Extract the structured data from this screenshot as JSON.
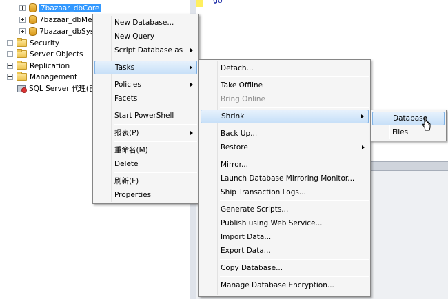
{
  "tree": {
    "databases": [
      "7bazaar_dbCore",
      "7bazaar_dbMer",
      "7bazaar_dbSyst"
    ],
    "folders": [
      "Security",
      "Server Objects",
      "Replication",
      "Management"
    ],
    "agent": "SQL Server 代理(已"
  },
  "editor": {
    "code": "go"
  },
  "menu1": {
    "new_database": "New Database...",
    "new_query": "New Query",
    "script_database_as": "Script Database as",
    "tasks": "Tasks",
    "policies": "Policies",
    "facets": "Facets",
    "start_powershell": "Start PowerShell",
    "reports": "报表(P)",
    "rename": "重命名(M)",
    "delete": "Delete",
    "refresh": "刷新(F)",
    "properties": "Properties"
  },
  "menu2": {
    "detach": "Detach...",
    "take_offline": "Take Offline",
    "bring_online": "Bring Online",
    "shrink": "Shrink",
    "back_up": "Back Up...",
    "restore": "Restore",
    "mirror": "Mirror...",
    "launch_mirroring_monitor": "Launch Database Mirroring Monitor...",
    "ship_transaction_logs": "Ship Transaction Logs...",
    "generate_scripts": "Generate Scripts...",
    "publish_web_service": "Publish using Web Service...",
    "import_data": "Import Data...",
    "export_data": "Export Data...",
    "copy_database": "Copy Database...",
    "manage_encryption": "Manage Database Encryption..."
  },
  "menu3": {
    "database": "Database",
    "files": "Files"
  }
}
